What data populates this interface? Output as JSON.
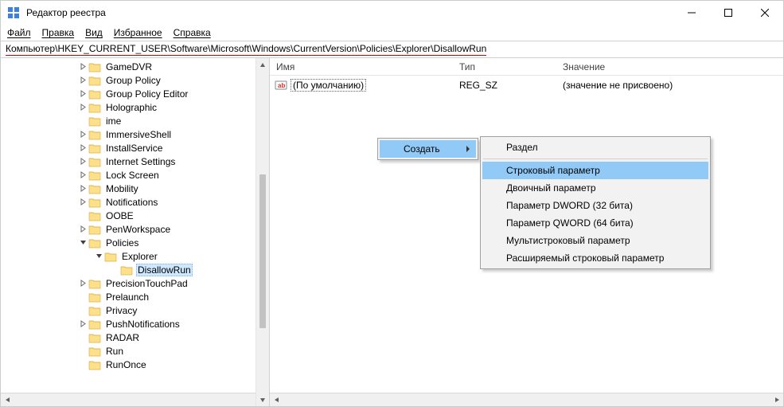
{
  "window": {
    "title": "Редактор реестра"
  },
  "menubar": [
    "Файл",
    "Правка",
    "Вид",
    "Избранное",
    "Справка"
  ],
  "address": "Компьютер\\HKEY_CURRENT_USER\\Software\\Microsoft\\Windows\\CurrentVersion\\Policies\\Explorer\\DisallowRun",
  "tree": [
    {
      "indent": 96,
      "exp": "closed",
      "label": "GameDVR",
      "selected": false
    },
    {
      "indent": 96,
      "exp": "closed",
      "label": "Group Policy",
      "selected": false
    },
    {
      "indent": 96,
      "exp": "closed",
      "label": "Group Policy Editor",
      "selected": false
    },
    {
      "indent": 96,
      "exp": "closed",
      "label": "Holographic",
      "selected": false
    },
    {
      "indent": 96,
      "exp": "none",
      "label": "ime",
      "selected": false
    },
    {
      "indent": 96,
      "exp": "closed",
      "label": "ImmersiveShell",
      "selected": false
    },
    {
      "indent": 96,
      "exp": "closed",
      "label": "InstallService",
      "selected": false
    },
    {
      "indent": 96,
      "exp": "closed",
      "label": "Internet Settings",
      "selected": false
    },
    {
      "indent": 96,
      "exp": "closed",
      "label": "Lock Screen",
      "selected": false
    },
    {
      "indent": 96,
      "exp": "closed",
      "label": "Mobility",
      "selected": false
    },
    {
      "indent": 96,
      "exp": "closed",
      "label": "Notifications",
      "selected": false
    },
    {
      "indent": 96,
      "exp": "none",
      "label": "OOBE",
      "selected": false
    },
    {
      "indent": 96,
      "exp": "closed",
      "label": "PenWorkspace",
      "selected": false
    },
    {
      "indent": 96,
      "exp": "open",
      "label": "Policies",
      "selected": false
    },
    {
      "indent": 116,
      "exp": "open",
      "label": "Explorer",
      "selected": false
    },
    {
      "indent": 136,
      "exp": "none",
      "label": "DisallowRun",
      "selected": true
    },
    {
      "indent": 96,
      "exp": "closed",
      "label": "PrecisionTouchPad",
      "selected": false
    },
    {
      "indent": 96,
      "exp": "none",
      "label": "Prelaunch",
      "selected": false
    },
    {
      "indent": 96,
      "exp": "none",
      "label": "Privacy",
      "selected": false
    },
    {
      "indent": 96,
      "exp": "closed",
      "label": "PushNotifications",
      "selected": false
    },
    {
      "indent": 96,
      "exp": "none",
      "label": "RADAR",
      "selected": false
    },
    {
      "indent": 96,
      "exp": "none",
      "label": "Run",
      "selected": false
    },
    {
      "indent": 96,
      "exp": "none",
      "label": "RunOnce",
      "selected": false
    }
  ],
  "columns": {
    "name": "Имя",
    "type": "Тип",
    "value": "Значение"
  },
  "values": [
    {
      "name": "(По умолчанию)",
      "type": "REG_SZ",
      "value": "(значение не присвоено)"
    }
  ],
  "context": {
    "parent": [
      {
        "label": "Создать",
        "highlight": true,
        "submenu": true
      }
    ],
    "submenu": [
      {
        "label": "Раздел",
        "sep_after": true
      },
      {
        "label": "Строковый параметр",
        "highlight": true
      },
      {
        "label": "Двоичный параметр"
      },
      {
        "label": "Параметр DWORD (32 бита)"
      },
      {
        "label": "Параметр QWORD (64 бита)"
      },
      {
        "label": "Мультистроковый параметр"
      },
      {
        "label": "Расширяемый строковый параметр"
      }
    ]
  }
}
